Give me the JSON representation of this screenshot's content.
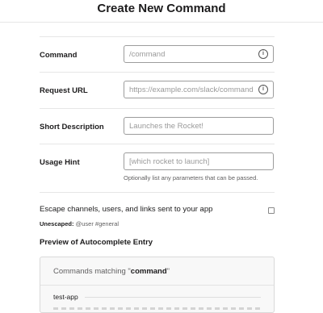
{
  "title": "Create New Command",
  "fields": [
    {
      "label": "Command",
      "placeholder": "/command",
      "info": true
    },
    {
      "label": "Request URL",
      "placeholder": "https://example.com/slack/command",
      "info": true
    },
    {
      "label": "Short Description",
      "placeholder": "Launches the Rocket!",
      "info": false
    },
    {
      "label": "Usage Hint",
      "placeholder": "[which rocket to launch]",
      "info": false,
      "help": "Optionally list any parameters that can be passed."
    }
  ],
  "escape": {
    "label": "Escape channels, users, and links sent to your app",
    "checked": false,
    "unescaped_label": "Unescaped:",
    "unescaped_value": "@user #general"
  },
  "preview": {
    "title": "Preview of Autocomplete Entry",
    "matching_prefix": "Commands matching \"",
    "matching_term": "command",
    "matching_suffix": "\"",
    "app_name": "test-app"
  }
}
